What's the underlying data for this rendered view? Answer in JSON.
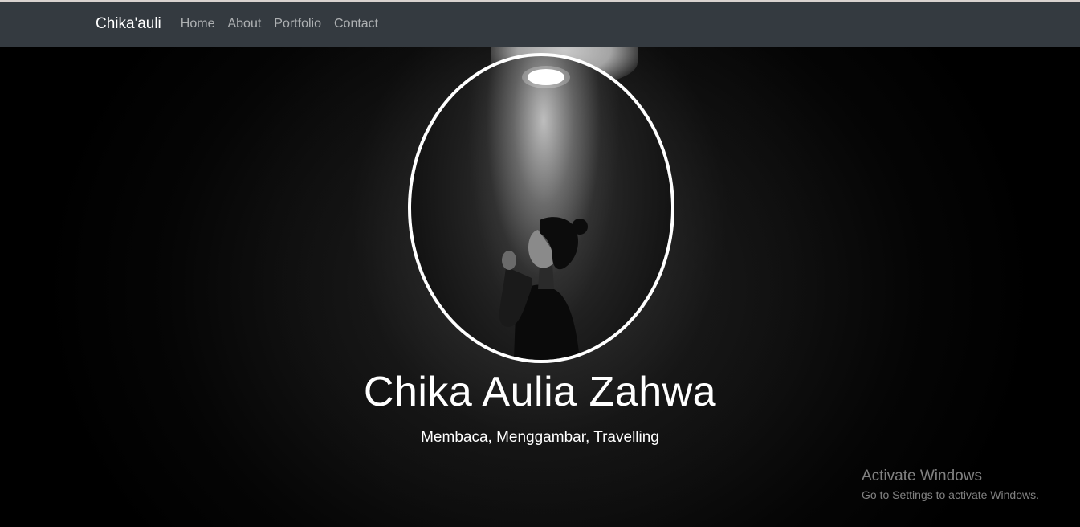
{
  "navbar": {
    "brand": "Chika'auli",
    "links": [
      "Home",
      "About",
      "Portfolio",
      "Contact"
    ],
    "background": "#343a40"
  },
  "hero": {
    "title": "Chika Aulia Zahwa",
    "subtitle": "Membaca, Menggambar, Travelling",
    "profile_image": "woman-under-spotlight-photo"
  },
  "watermark": {
    "title": "Activate Windows",
    "subtitle": "Go to Settings to activate Windows."
  }
}
